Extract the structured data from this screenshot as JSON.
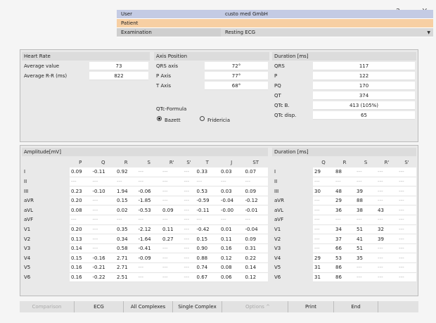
{
  "window": {
    "help": "?",
    "minimize": "_",
    "close": "X"
  },
  "header": {
    "rows": [
      {
        "key": "User",
        "value": "custo med GmbH"
      },
      {
        "key": "Patient",
        "value": ""
      },
      {
        "key": "Examination",
        "value": "Resting ECG"
      }
    ],
    "dropdown_glyph": "▼"
  },
  "heart_rate": {
    "title": "Heart Rate",
    "rows": [
      {
        "label": "Average value",
        "value": "73"
      },
      {
        "label": "Average R-R (ms)",
        "value": "822"
      }
    ]
  },
  "axis": {
    "title": "Axis Position",
    "rows": [
      {
        "label": "QRS axis",
        "value": "72°"
      },
      {
        "label": "P Axis",
        "value": "77°"
      },
      {
        "label": "T Axis",
        "value": "68°"
      }
    ],
    "qtc_label": "QTc-Formula",
    "options": [
      {
        "label": "Bazett",
        "selected": true
      },
      {
        "label": "Fridericia",
        "selected": false
      }
    ]
  },
  "duration": {
    "title": "Duration [ms]",
    "rows": [
      {
        "label": "QRS",
        "value": "117"
      },
      {
        "label": "P",
        "value": "122"
      },
      {
        "label": "PQ",
        "value": "170"
      },
      {
        "label": "QT",
        "value": "374"
      },
      {
        "label": "QTc B.",
        "value": "413 (105%)"
      },
      {
        "label": "QTc disp.",
        "value": "65"
      }
    ]
  },
  "amplitude": {
    "title": "Amplitude[mV]",
    "columns": [
      "P",
      "Q",
      "R",
      "S",
      "R'",
      "S'",
      "T",
      "J",
      "ST"
    ],
    "rows": [
      {
        "lead": "I",
        "values": [
          "0.09",
          "-0.11",
          "0.92",
          "---",
          "---",
          "---",
          "0.33",
          "0.03",
          "0.07"
        ]
      },
      {
        "lead": "II",
        "values": [
          "---",
          "---",
          "---",
          "---",
          "---",
          "---",
          "---",
          "---",
          "---"
        ]
      },
      {
        "lead": "III",
        "values": [
          "0.23",
          "-0.10",
          "1.94",
          "-0.06",
          "---",
          "---",
          "0.53",
          "0.03",
          "0.09"
        ]
      },
      {
        "lead": "aVR",
        "values": [
          "0.20",
          "---",
          "0.15",
          "-1.85",
          "---",
          "---",
          "-0.59",
          "-0.04",
          "-0.12"
        ]
      },
      {
        "lead": "aVL",
        "values": [
          "0.08",
          "---",
          "0.02",
          "-0.53",
          "0.09",
          "---",
          "-0.11",
          "-0.00",
          "-0.01"
        ]
      },
      {
        "lead": "aVF",
        "values": [
          "---",
          "---",
          "---",
          "---",
          "---",
          "---",
          "---",
          "---",
          "---"
        ]
      },
      {
        "lead": "V1",
        "values": [
          "0.20",
          "---",
          "0.35",
          "-2.12",
          "0.11",
          "---",
          "-0.42",
          "0.01",
          "-0.04"
        ]
      },
      {
        "lead": "V2",
        "values": [
          "0.13",
          "---",
          "0.34",
          "-1.64",
          "0.27",
          "---",
          "0.15",
          "0.11",
          "0.09"
        ]
      },
      {
        "lead": "V3",
        "values": [
          "0.14",
          "---",
          "0.58",
          "-0.41",
          "---",
          "---",
          "0.90",
          "0.16",
          "0.31"
        ]
      },
      {
        "lead": "V4",
        "values": [
          "0.15",
          "-0.16",
          "2.71",
          "-0.09",
          "---",
          "---",
          "0.88",
          "0.12",
          "0.22"
        ]
      },
      {
        "lead": "V5",
        "values": [
          "0.16",
          "-0.21",
          "2.71",
          "---",
          "---",
          "---",
          "0.74",
          "0.08",
          "0.14"
        ]
      },
      {
        "lead": "V6",
        "values": [
          "0.16",
          "-0.22",
          "2.51",
          "---",
          "---",
          "---",
          "0.67",
          "0.06",
          "0.12"
        ]
      }
    ]
  },
  "duration2": {
    "title": "Duration [ms]",
    "columns": [
      "Q",
      "R",
      "S",
      "R'",
      "S'"
    ],
    "rows": [
      {
        "lead": "I",
        "values": [
          "29",
          "88",
          "---",
          "---",
          "---"
        ]
      },
      {
        "lead": "II",
        "values": [
          "---",
          "---",
          "---",
          "---",
          "---"
        ]
      },
      {
        "lead": "III",
        "values": [
          "30",
          "48",
          "39",
          "---",
          "---"
        ]
      },
      {
        "lead": "aVR",
        "values": [
          "---",
          "29",
          "88",
          "---",
          "---"
        ]
      },
      {
        "lead": "aVL",
        "values": [
          "---",
          "36",
          "38",
          "43",
          "---"
        ]
      },
      {
        "lead": "aVF",
        "values": [
          "---",
          "---",
          "---",
          "---",
          "---"
        ]
      },
      {
        "lead": "V1",
        "values": [
          "---",
          "34",
          "51",
          "32",
          "---"
        ]
      },
      {
        "lead": "V2",
        "values": [
          "---",
          "37",
          "41",
          "39",
          "---"
        ]
      },
      {
        "lead": "V3",
        "values": [
          "---",
          "66",
          "51",
          "---",
          "---"
        ]
      },
      {
        "lead": "V4",
        "values": [
          "29",
          "53",
          "35",
          "---",
          "---"
        ]
      },
      {
        "lead": "V5",
        "values": [
          "31",
          "86",
          "---",
          "---",
          "---"
        ]
      },
      {
        "lead": "V6",
        "values": [
          "31",
          "86",
          "---",
          "---",
          "---"
        ]
      }
    ]
  },
  "buttons": [
    {
      "label": "Comparison",
      "enabled": false
    },
    {
      "label": "ECG",
      "enabled": true
    },
    {
      "label": "All Complexes",
      "enabled": true
    },
    {
      "label": "Single Complex",
      "enabled": true
    },
    {
      "label": "Options   ^",
      "enabled": false
    },
    {
      "label": "Print",
      "enabled": true
    },
    {
      "label": "End",
      "enabled": true
    }
  ]
}
